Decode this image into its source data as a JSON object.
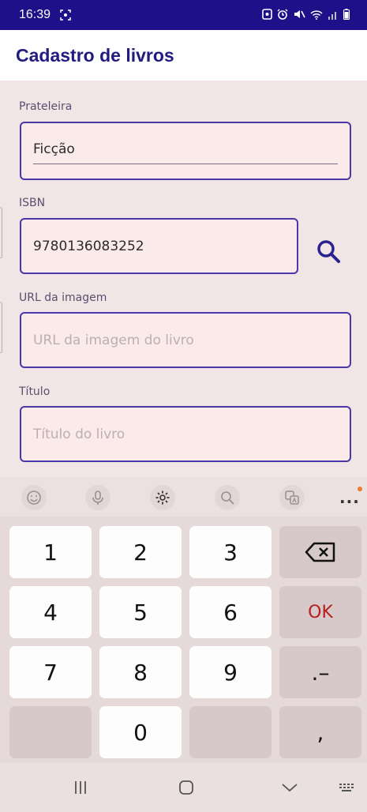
{
  "status_bar": {
    "time": "16:39",
    "icons": [
      "screen-capture-icon",
      "sim-icon",
      "alarm-icon",
      "mute-icon",
      "wifi-icon",
      "signal-icon",
      "battery-icon"
    ]
  },
  "app_bar": {
    "title": "Cadastro de livros"
  },
  "form": {
    "shelf": {
      "label": "Prateleira",
      "value": "Ficção"
    },
    "isbn": {
      "label": "ISBN",
      "value": "9780136083252"
    },
    "image_url": {
      "label": "URL da imagem",
      "placeholder": "URL da imagem do livro"
    },
    "title": {
      "label": "Título",
      "placeholder": "Título do livro"
    }
  },
  "keyboard_toolbar": {
    "icons": [
      "emoji-icon",
      "microphone-icon",
      "settings-icon",
      "search-icon",
      "translate-icon",
      "more-icon"
    ],
    "more_label": "..."
  },
  "keyboard": {
    "keys": [
      "1",
      "2",
      "3",
      "4",
      "5",
      "6",
      "7",
      "8",
      "9",
      "0"
    ],
    "ok_label": "OK",
    "dot_dash_label": ".–",
    "comma_label": ","
  },
  "nav_bar": {
    "icons": [
      "recent-apps-icon",
      "home-icon",
      "back-icon",
      "keyboard-switch-icon"
    ]
  },
  "colors": {
    "accent": "#221b80",
    "status_bar": "#1e1088",
    "field_border": "#4a38a8",
    "ok_key": "#b52020"
  }
}
